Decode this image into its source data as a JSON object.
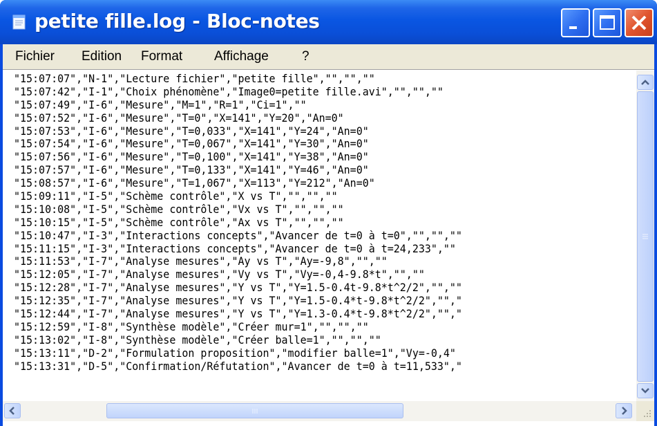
{
  "window": {
    "title": "petite fille.log - Bloc-notes",
    "icon": "notepad-icon",
    "controls": [
      "minimize-icon",
      "maximize-icon",
      "close-icon"
    ],
    "titlebar_color": "#0a56e2",
    "close_color": "#e0542e"
  },
  "menu": {
    "items": [
      "Fichier",
      "Edition",
      "Format",
      "Affichage",
      "?"
    ]
  },
  "document": {
    "lines": [
      "\"15:07:07\",\"N-1\",\"Lecture fichier\",\"petite fille\",\"\",\"\",\"\"",
      "\"15:07:42\",\"I-1\",\"Choix phénomène\",\"Image0=petite fille.avi\",\"\",\"\",\"\"",
      "\"15:07:49\",\"I-6\",\"Mesure\",\"M=1\",\"R=1\",\"Ci=1\",\"\"",
      "\"15:07:52\",\"I-6\",\"Mesure\",\"T=0\",\"X=141\",\"Y=20\",\"An=0\"",
      "\"15:07:53\",\"I-6\",\"Mesure\",\"T=0,033\",\"X=141\",\"Y=24\",\"An=0\"",
      "\"15:07:54\",\"I-6\",\"Mesure\",\"T=0,067\",\"X=141\",\"Y=30\",\"An=0\"",
      "\"15:07:56\",\"I-6\",\"Mesure\",\"T=0,100\",\"X=141\",\"Y=38\",\"An=0\"",
      "\"15:07:57\",\"I-6\",\"Mesure\",\"T=0,133\",\"X=141\",\"Y=46\",\"An=0\"",
      "\"15:08:57\",\"I-6\",\"Mesure\",\"T=1,067\",\"X=113\",\"Y=212\",\"An=0\"",
      "\"15:09:11\",\"I-5\",\"Schème contrôle\",\"X vs T\",\"\",\"\",\"\"",
      "\"15:10:08\",\"I-5\",\"Schème contrôle\",\"Vx vs T\",\"\",\"\",\"\"",
      "\"15:10:15\",\"I-5\",\"Schème contrôle\",\"Ax vs T\",\"\",\"\",\"\"",
      "\"15:10:47\",\"I-3\",\"Interactions concepts\",\"Avancer de t=0 à t=0\",\"\",\"\",\"\"",
      "\"15:11:15\",\"I-3\",\"Interactions concepts\",\"Avancer de t=0 à t=24,233\",\"\"",
      "\"15:11:53\",\"I-7\",\"Analyse mesures\",\"Ay vs T\",\"Ay=-9,8\",\"\",\"\"",
      "\"15:12:05\",\"I-7\",\"Analyse mesures\",\"Vy vs T\",\"Vy=-0,4-9.8*t\",\"\",\"\"",
      "\"15:12:28\",\"I-7\",\"Analyse mesures\",\"Y vs T\",\"Y=1.5-0.4t-9.8*t^2/2\",\"\",\"\"",
      "\"15:12:35\",\"I-7\",\"Analyse mesures\",\"Y vs T\",\"Y=1.5-0.4*t-9.8*t^2/2\",\"\",\"",
      "\"15:12:44\",\"I-7\",\"Analyse mesures\",\"Y vs T\",\"Y=1.3-0.4*t-9.8*t^2/2\",\"\",\"",
      "\"15:12:59\",\"I-8\",\"Synthèse modèle\",\"Créer mur=1\",\"\",\"\",\"\"",
      "\"15:13:02\",\"I-8\",\"Synthèse modèle\",\"Créer balle=1\",\"\",\"\",\"\"",
      "\"15:13:11\",\"D-2\",\"Formulation proposition\",\"modifier balle=1\",\"Vy=-0,4\"",
      "\"15:13:31\",\"D-5\",\"Confirmation/Réfutation\",\"Avancer de t=0 à t=11,533\",\""
    ]
  },
  "scrollbars": {
    "vertical": [
      "scroll-up-icon",
      "scroll-down-icon"
    ],
    "horizontal": [
      "scroll-left-icon",
      "scroll-right-icon"
    ]
  }
}
